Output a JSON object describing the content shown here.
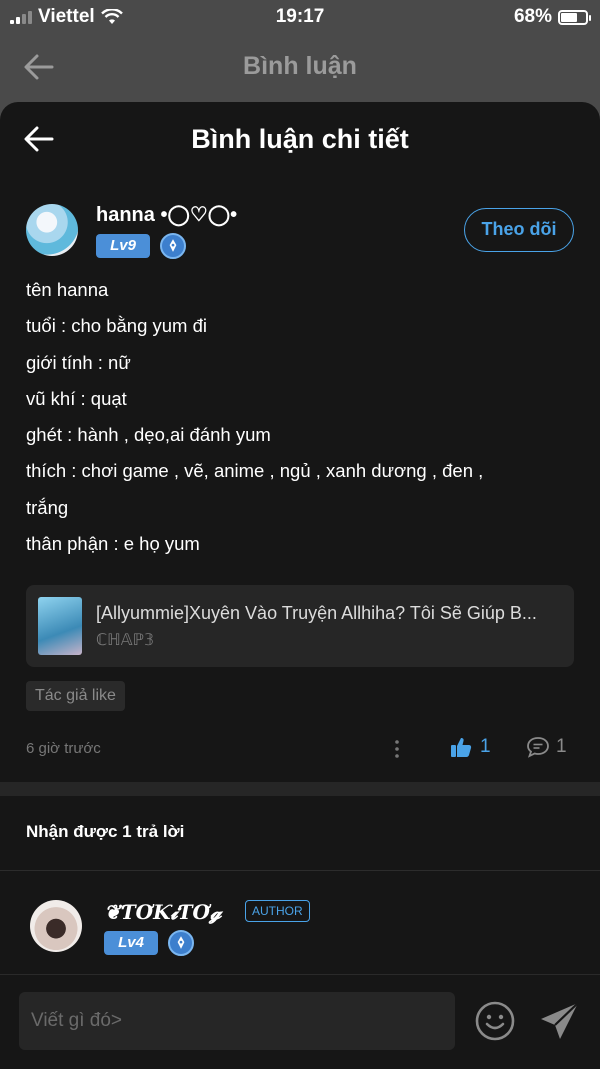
{
  "status_bar": {
    "carrier": "Viettel",
    "time": "19:17",
    "battery_percent": "68%",
    "battery_level": 0.68
  },
  "top_nav": {
    "title": "Bình luận",
    "back_icon": "arrow-left-icon"
  },
  "sheet": {
    "title": "Bình luận chi tiết",
    "back_icon": "arrow-left-icon"
  },
  "comment": {
    "username": "hanna •◯♡◯•",
    "level": "Lv9",
    "follow_label": "Theo dõi",
    "body_lines": [
      "tên hanna",
      "tuổi : cho bằng yum đi",
      "giới tính : nữ",
      "vũ khí : quạt",
      "ghét : hành , dẹo,ai đánh yum",
      "thích : chơi game , vẽ, anime , ngủ , xanh dương , đen ,",
      "trắng",
      "thân phận : e họ yum"
    ],
    "story": {
      "title": "[Allyummie]Xuyên Vào Truyện Allhiha? Tôi Sẽ Giúp B...",
      "chapter": "ℂℍ𝔸ℙ𝟛"
    },
    "tag": "Tác giả like",
    "time_ago": "6 giờ trước",
    "like_count": "1",
    "reply_count": "1"
  },
  "replies": {
    "heading": "Nhận được 1 trả lời",
    "items": [
      {
        "username": "❦ƬƠƘ𝓲ƬƠ𝓰",
        "role_badge": "AUTHOR",
        "level": "Lv4"
      }
    ]
  },
  "composer": {
    "placeholder": "Viết gì đó>",
    "emoji_icon": "smiley-icon",
    "send_icon": "send-icon"
  },
  "colors": {
    "accent": "#4aa3e8",
    "background": "#161616",
    "level_badge": "#4b8fd8"
  }
}
